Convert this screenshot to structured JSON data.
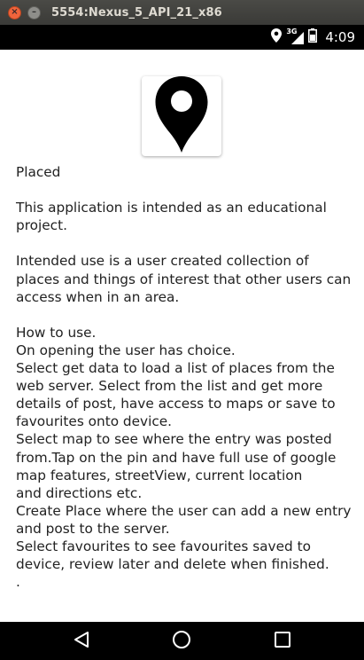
{
  "window": {
    "title": "5554:Nexus_5_API_21_x86",
    "close_glyph": "×",
    "minimize_glyph": "–"
  },
  "status_bar": {
    "network_label": "3G",
    "time": "4:09"
  },
  "app": {
    "name": "Placed",
    "icon": "map-pin-icon"
  },
  "content": {
    "paragraphs": [
      "Placed",
      "This application is intended as an educational project.",
      "Intended use is a user created collection of places and things of interest that other users can access when in an area.",
      "How to use.\nOn opening the user has choice.\nSelect get data to load a list of places from the web server. Select from the list and get more details of post, have access to maps or save to favourites onto device.\nSelect map to see where the entry was posted from.Tap on the pin and have full use of google map features, streetView, current location\nand directions etc.\nCreate Place where the user can add a new entry and post to the server.\nSelect favourites to see favourites saved to device, review later and delete when finished.\n."
    ]
  },
  "nav_bar": {
    "back_icon": "back-icon",
    "home_icon": "home-icon",
    "recents_icon": "recents-icon"
  },
  "colors": {
    "titlebar": "#3f3f3c",
    "statusbar": "#000000",
    "navbar": "#000000",
    "text": "#222222",
    "close_button": "#f0643c"
  }
}
